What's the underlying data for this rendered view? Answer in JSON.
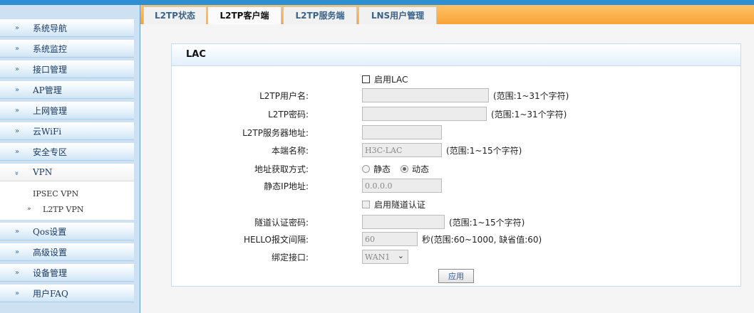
{
  "tabs": [
    {
      "label": "L2TP状态",
      "active": false
    },
    {
      "label": "L2TP客户端",
      "active": true
    },
    {
      "label": "L2TP服务端",
      "active": false
    },
    {
      "label": "LNS用户管理",
      "active": false
    }
  ],
  "sidebar": {
    "items": [
      {
        "label": "系统导航"
      },
      {
        "label": "系统监控"
      },
      {
        "label": "接口管理"
      },
      {
        "label": "AP管理"
      },
      {
        "label": "上网管理"
      },
      {
        "label": "云WiFi"
      },
      {
        "label": "安全专区"
      },
      {
        "label": "VPN",
        "expanded": true,
        "sub_items": [
          {
            "label": "IPSEC VPN",
            "selected": false
          },
          {
            "label": "L2TP VPN",
            "selected": true
          }
        ]
      },
      {
        "label": "Qos设置"
      },
      {
        "label": "高级设置"
      },
      {
        "label": "设备管理"
      },
      {
        "label": "用户FAQ"
      }
    ]
  },
  "panel": {
    "title": "LAC",
    "enable_lac": {
      "label": "启用LAC",
      "checked": false
    },
    "username": {
      "label": "L2TP用户名:",
      "value": "",
      "hint": "(范围:1~31个字符)"
    },
    "password": {
      "label": "L2TP密码:",
      "value": "",
      "hint": "(范围:1~31个字符)"
    },
    "server": {
      "label": "L2TP服务器地址:",
      "value": ""
    },
    "local_name": {
      "label": "本端名称:",
      "value": "H3C-LAC",
      "hint": "(范围:1~15个字符)"
    },
    "addr_mode": {
      "label": "地址获取方式:",
      "options": [
        "静态",
        "动态"
      ],
      "selected": "动态"
    },
    "static_ip": {
      "label": "静态IP地址:",
      "value": "0.0.0.0"
    },
    "tunnel_auth": {
      "label": "启用隧道认证",
      "checked": false
    },
    "tunnel_pwd": {
      "label": "隧道认证密码:",
      "value": "",
      "hint": "(范围:1~15个字符)"
    },
    "hello": {
      "label": "HELLO报文间隔:",
      "value": "60",
      "hint": "秒(范围:60~1000, 缺省值:60)"
    },
    "bind_iface": {
      "label": "绑定接口:",
      "value": "WAN1"
    },
    "apply_label": "应用"
  }
}
